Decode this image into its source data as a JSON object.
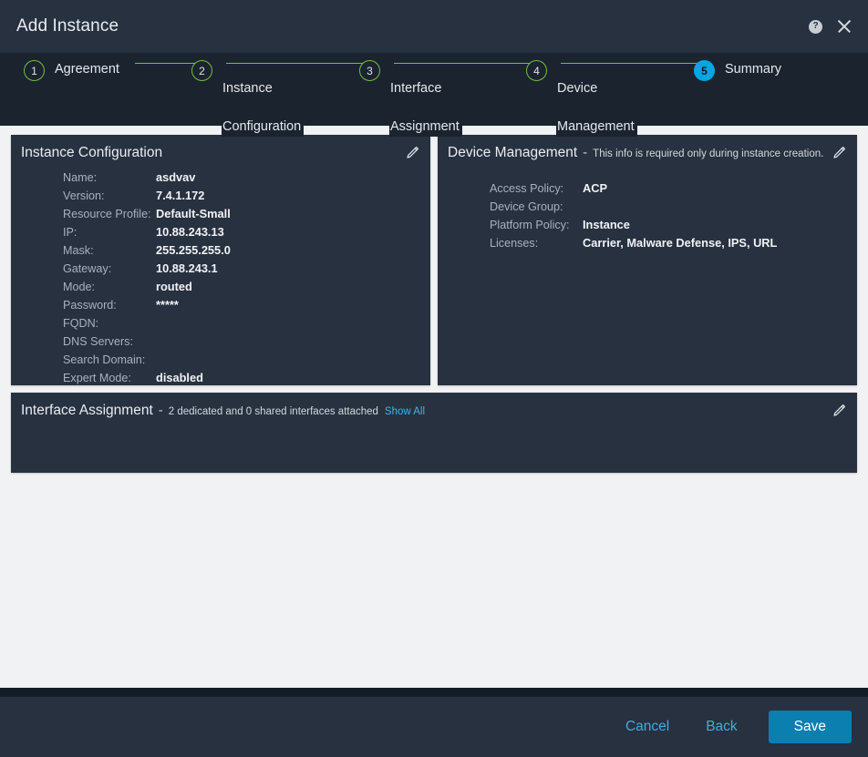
{
  "window": {
    "title": "Add Instance",
    "help_icon": "help-circle-icon",
    "close_icon": "close-icon"
  },
  "stepper": {
    "steps": [
      {
        "number": "1",
        "label": "Agreement",
        "state": "complete"
      },
      {
        "number": "2",
        "label": "Instance\nConfiguration",
        "state": "complete"
      },
      {
        "number": "3",
        "label": "Interface\nAssignment",
        "state": "complete"
      },
      {
        "number": "4",
        "label": "Device\nManagement",
        "state": "complete"
      },
      {
        "number": "5",
        "label": "Summary",
        "state": "active"
      }
    ],
    "colors": {
      "complete": "#73bf44",
      "active": "#00a6e3"
    }
  },
  "cards": {
    "instance_configuration": {
      "title": "Instance Configuration",
      "edit_icon": "pencil-icon",
      "fields": [
        {
          "label": "Name:",
          "value": "asdvav"
        },
        {
          "label": "Version:",
          "value": "7.4.1.172"
        },
        {
          "label": "Resource Profile:",
          "value": "Default-Small"
        },
        {
          "label": "IP:",
          "value": "10.88.243.13"
        },
        {
          "label": "Mask:",
          "value": "255.255.255.0"
        },
        {
          "label": "Gateway:",
          "value": "10.88.243.1"
        },
        {
          "label": "Mode:",
          "value": "routed"
        },
        {
          "label": "Password:",
          "value": "*****"
        },
        {
          "label": "FQDN:",
          "value": ""
        },
        {
          "label": "DNS Servers:",
          "value": ""
        },
        {
          "label": "Search Domain:",
          "value": ""
        },
        {
          "label": "Expert Mode:",
          "value": "disabled"
        }
      ]
    },
    "device_management": {
      "title": "Device Management",
      "dash": "-",
      "subtitle": "This info is required only during instance creation.",
      "edit_icon": "pencil-icon",
      "fields": [
        {
          "label": "Access Policy:",
          "value": "ACP"
        },
        {
          "label": "Device Group:",
          "value": ""
        },
        {
          "label": "Platform Policy:",
          "value": "Instance"
        },
        {
          "label": "Licenses:",
          "value": "Carrier, Malware Defense, IPS, URL"
        }
      ]
    },
    "interface_assignment": {
      "title": "Interface Assignment",
      "dash": "-",
      "subtitle": "2 dedicated and 0 shared interfaces attached",
      "show_all": "Show All",
      "edit_icon": "pencil-icon"
    }
  },
  "footer": {
    "cancel": "Cancel",
    "back": "Back",
    "save": "Save",
    "save_color": "#0a7fb0"
  }
}
